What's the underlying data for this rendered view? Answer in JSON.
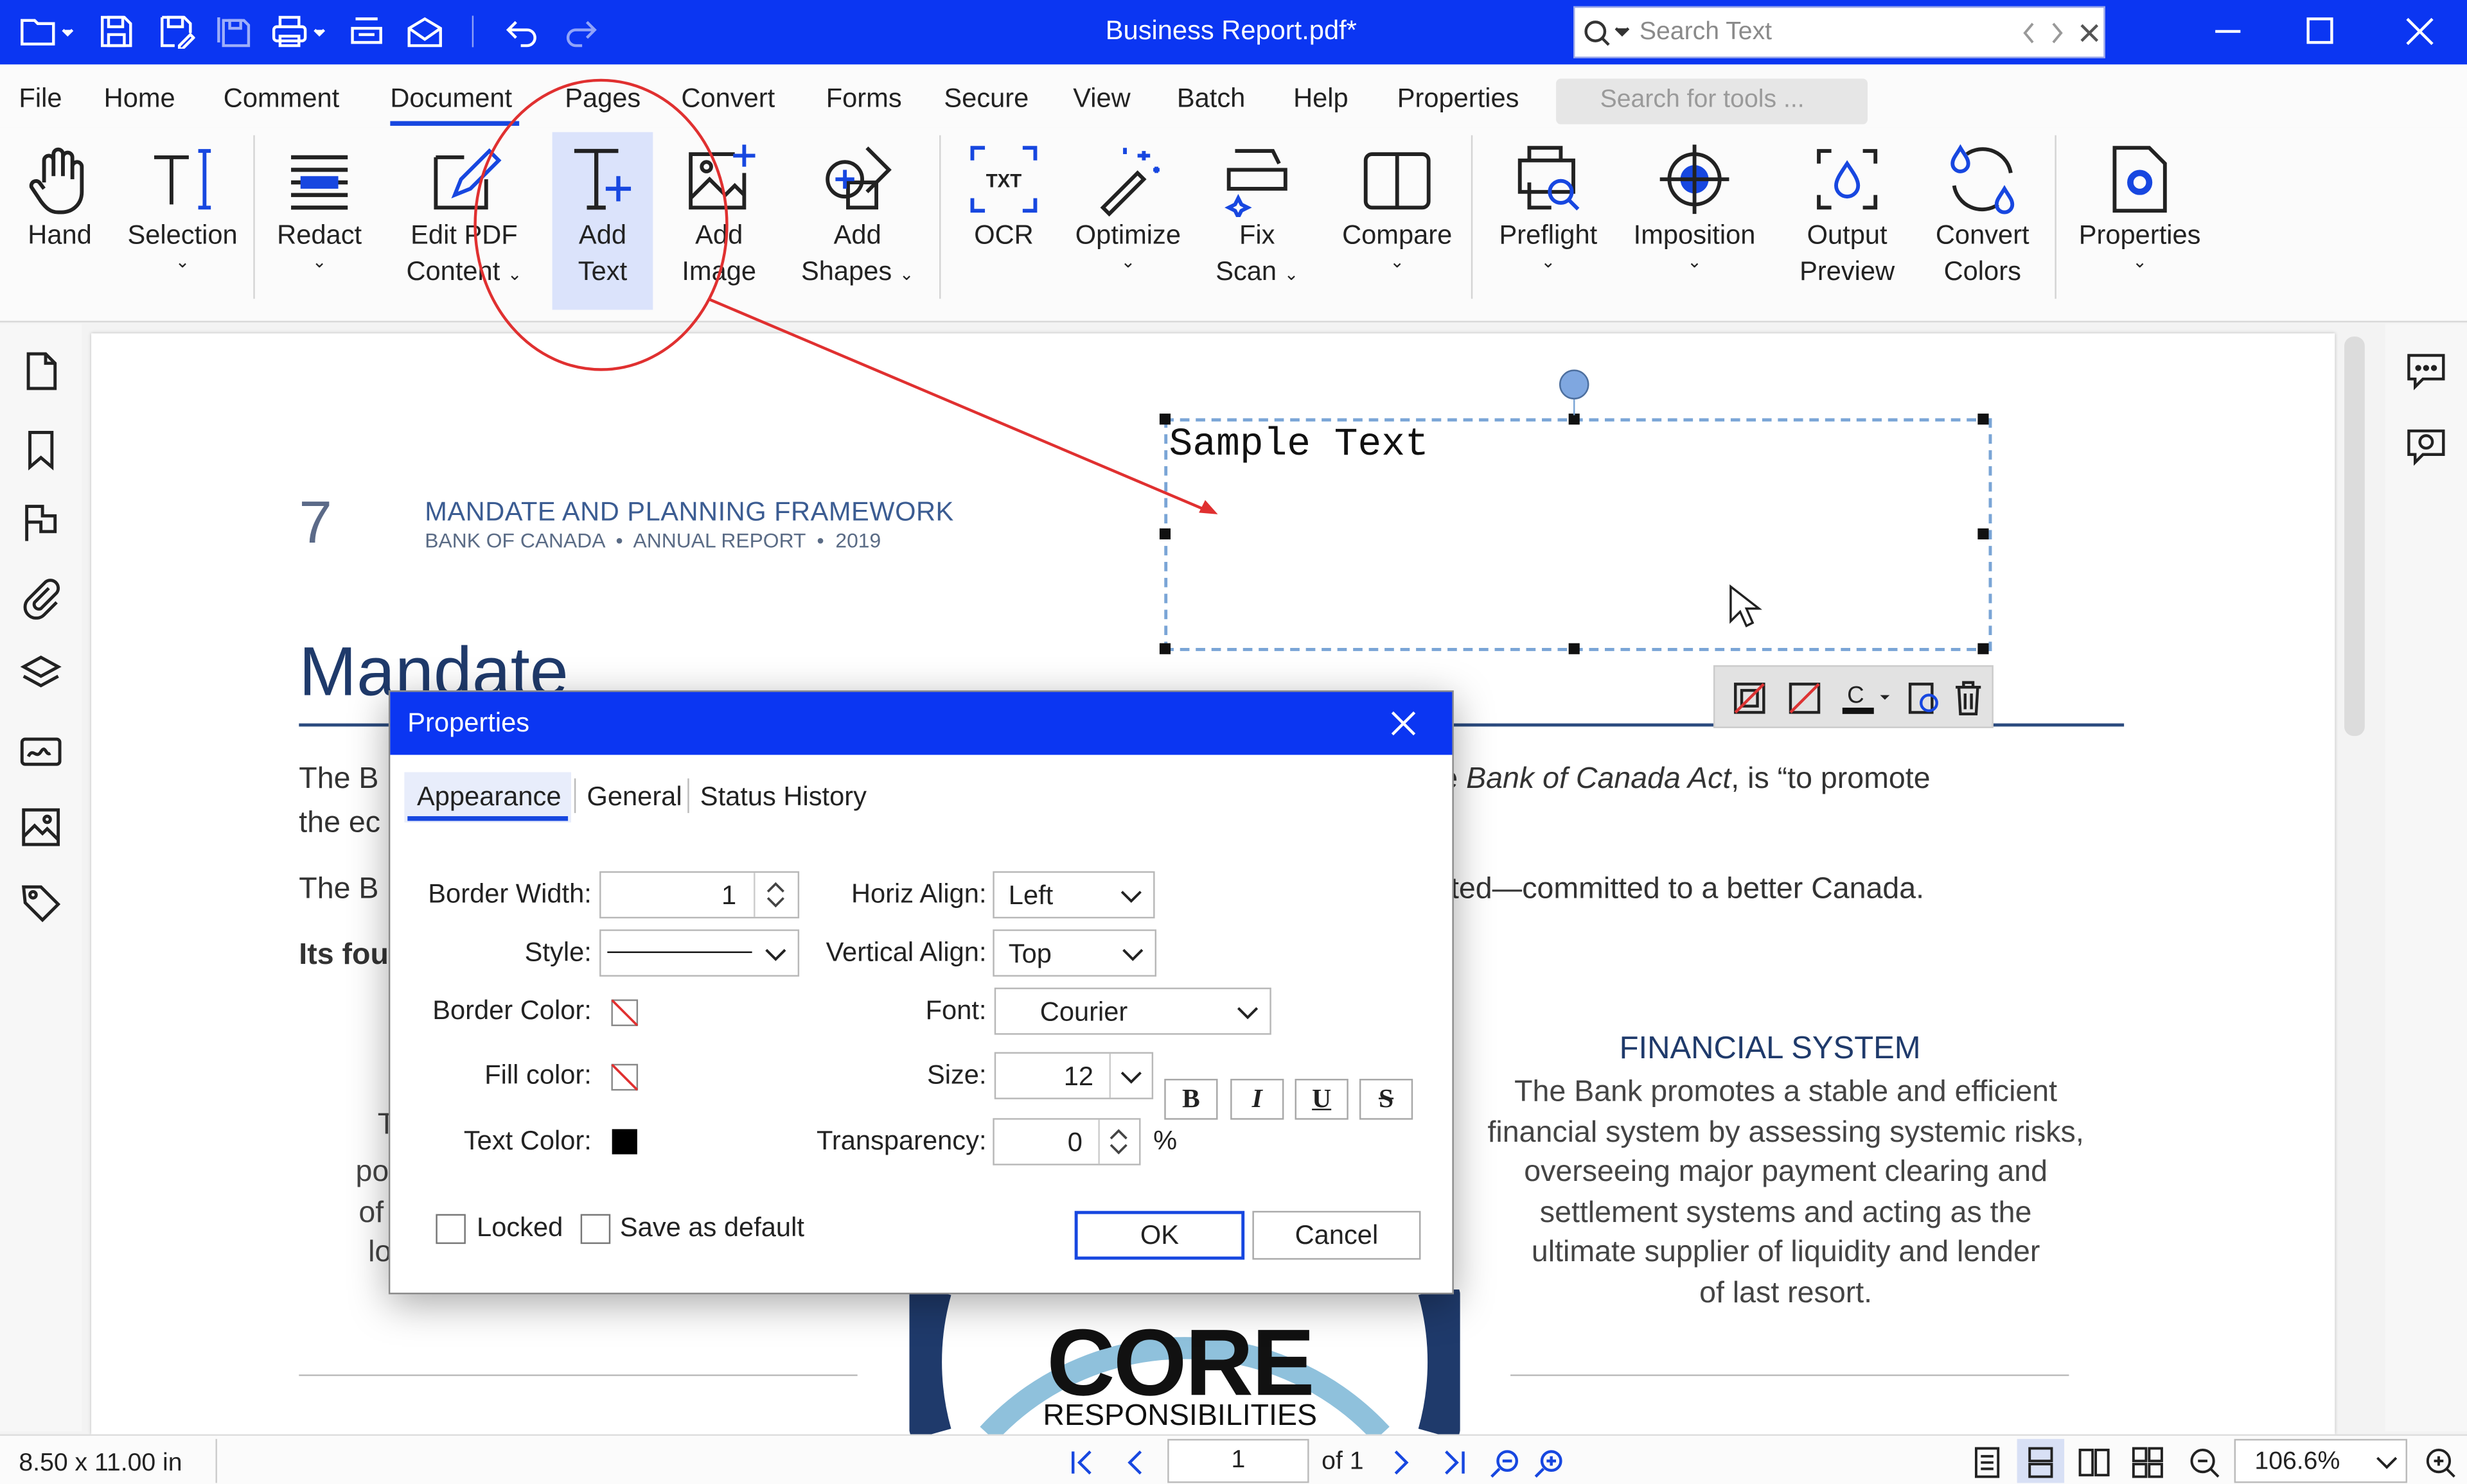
{
  "window": {
    "title": "Business Report.pdf*"
  },
  "search": {
    "placeholder": "Search Text"
  },
  "menu": [
    "File",
    "Home",
    "Comment",
    "Document",
    "Pages",
    "Convert",
    "Forms",
    "Secure",
    "View",
    "Batch",
    "Help",
    "Properties"
  ],
  "tool_search": {
    "placeholder": "Search for tools ..."
  },
  "ribbon": {
    "hand": "Hand",
    "selection": "Selection",
    "redact": "Redact",
    "edit_pdf_1": "Edit PDF",
    "edit_pdf_2": "Content",
    "add_text_1": "Add",
    "add_text_2": "Text",
    "add_image_1": "Add",
    "add_image_2": "Image",
    "add_shapes_1": "Add",
    "add_shapes_2": "Shapes",
    "ocr": "OCR",
    "optimize": "Optimize",
    "fix_scan_1": "Fix",
    "fix_scan_2": "Scan",
    "compare": "Compare",
    "preflight": "Preflight",
    "imposition": "Imposition",
    "output_preview_1": "Output",
    "output_preview_2": "Preview",
    "convert_colors_1": "Convert",
    "convert_colors_2": "Colors",
    "properties": "Properties"
  },
  "page": {
    "page_number": "7",
    "header_title": "MANDATE AND PLANNING FRAMEWORK",
    "header_sub": "BANK OF CANADA  •  ANNUAL REPORT  •  2019",
    "heading": "Mandate",
    "para1_left": "The B",
    "para1_right_a": "e ",
    "para1_right_italic": "Bank of Canada Act",
    "para1_right_b": ", is “to promote",
    "para1_left2": "the ec",
    "para2_left": "The B",
    "para2_right": "ted—committed to a better Canada.",
    "para3_left": "Its fou",
    "frag_t": "T",
    "frag_po": "po",
    "frag_of": "of",
    "frag_lo": "lo",
    "fin_title": "FINANCIAL SYSTEM",
    "fin_lines": [
      "The Bank promotes a stable and efficient",
      "financial system by assessing systemic risks,",
      "overseeing major payment clearing and",
      "settlement systems and acting as the",
      "ultimate supplier of liquidity and lender",
      "of  last resort."
    ],
    "core": "CORE",
    "responsibilities": "RESPONSIBILITIES",
    "textbox_text": "Sample Text"
  },
  "dialog": {
    "title": "Properties",
    "tabs": [
      "Appearance",
      "General",
      "Status History"
    ],
    "border_width_label": "Border Width:",
    "border_width_value": "1",
    "style_label": "Style:",
    "border_color_label": "Border Color:",
    "fill_color_label": "Fill color:",
    "text_color_label": "Text Color:",
    "horiz_align_label": "Horiz Align:",
    "horiz_align_value": "Left",
    "vert_align_label": "Vertical Align:",
    "vert_align_value": "Top",
    "font_label": "Font:",
    "font_value": "Courier",
    "size_label": "Size:",
    "size_value": "12",
    "bold": "B",
    "italic": "I",
    "underline": "U",
    "strike": "S",
    "transparency_label": "Transparency:",
    "transparency_value": "0",
    "percent": "%",
    "locked_label": "Locked",
    "save_default_label": "Save as default",
    "ok": "OK",
    "cancel": "Cancel"
  },
  "status": {
    "page_size": "8.50 x 11.00 in",
    "current_page": "1",
    "of_pages": "of 1",
    "zoom": "106.6%"
  },
  "colors": {
    "accent": "#0b36f2",
    "annotation_red": "#e03030",
    "heading_navy": "#1f3a6b"
  }
}
